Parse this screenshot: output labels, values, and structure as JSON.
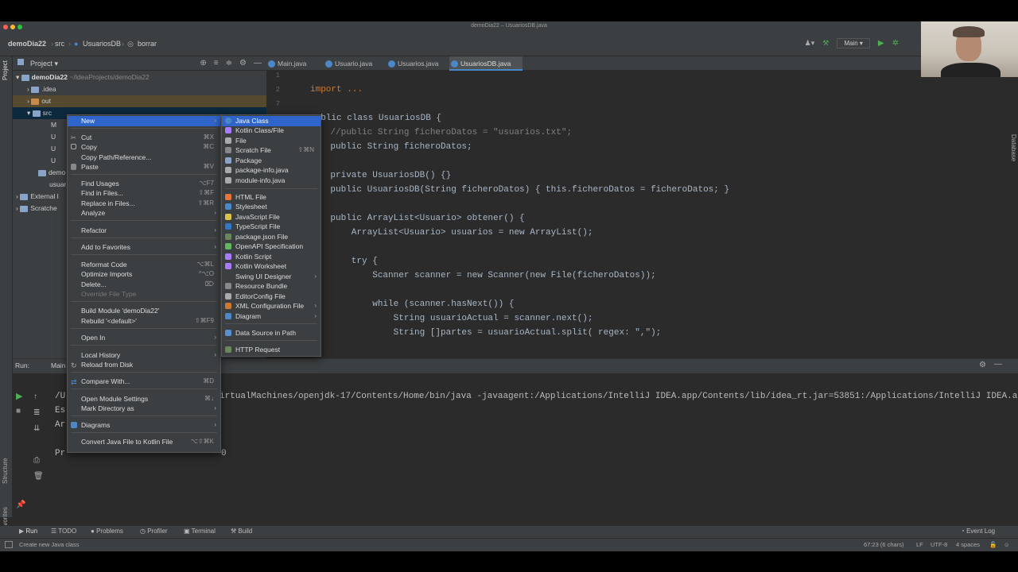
{
  "window": {
    "title": "demoDia22 – UsuariosDB.java"
  },
  "navbar": {
    "project": "demoDia22",
    "src": "src",
    "file": "UsuariosDB",
    "folder": "borrar",
    "run_config": "Main"
  },
  "project_panel": {
    "title": "Project",
    "strip_label": "Project",
    "root": "demoDia22",
    "root_path": "~/IdeaProjects/demoDia22",
    "items": [
      ".idea",
      "out",
      "src",
      "M",
      "U",
      "U",
      "U",
      "demo",
      "usuar",
      "External l",
      "Scratche"
    ]
  },
  "tabs": [
    {
      "label": "Main.java"
    },
    {
      "label": "Usuario.java"
    },
    {
      "label": "Usuarios.java"
    },
    {
      "label": "UsuariosDB.java"
    }
  ],
  "editor": {
    "line_numbers": [
      "1",
      "2",
      "7"
    ],
    "lines": [
      {
        "t": "import ..."
      },
      {
        "t": "public class UsuariosDB {"
      },
      {
        "t": "    //public String ficheroDatos = \"usuarios.txt\";"
      },
      {
        "t": "    public String ficheroDatos;"
      },
      {
        "t": "    private UsuariosDB() {}"
      },
      {
        "t": "    public UsuariosDB(String ficheroDatos) { this.ficheroDatos = ficheroDatos; }"
      },
      {
        "t": "    public ArrayList<Usuario> obtener() {"
      },
      {
        "t": "        ArrayList<Usuario> usuarios = new ArrayList();"
      },
      {
        "t": "        try {"
      },
      {
        "t": "            Scanner scanner = new Scanner(new File(ficheroDatos));"
      },
      {
        "t": "            while (scanner.hasNext()) {"
      },
      {
        "t": "                String usuarioActual = scanner.next();"
      },
      {
        "t": "                String []partes = usuarioActual.split( regex: \",\");"
      }
    ]
  },
  "run": {
    "label": "Run:",
    "tab": "Main",
    "cmd": "irtualMachines/openjdk-17/Contents/Home/bin/java -javaagent:/Applications/IntelliJ IDEA.app/Contents/lib/idea_rt.jar=53851:/Applications/IntelliJ IDEA.a",
    "out_lines": [
      "/U",
      "Es",
      "Ar",
      "",
      "Pr"
    ],
    "tail": "0"
  },
  "context_menu": [
    {
      "label": "New",
      "sub": true,
      "hl": true
    },
    {
      "label": "Cut",
      "sc": "⌘X"
    },
    {
      "label": "Copy",
      "sc": "⌘C"
    },
    {
      "label": "Copy Path/Reference..."
    },
    {
      "label": "Paste",
      "sc": "⌘V"
    },
    {
      "label": "Find Usages",
      "sc": "⌥F7"
    },
    {
      "label": "Find in Files...",
      "sc": "⇧⌘F"
    },
    {
      "label": "Replace in Files...",
      "sc": "⇧⌘R"
    },
    {
      "label": "Analyze",
      "sub": true
    },
    {
      "label": "Refactor",
      "sub": true
    },
    {
      "label": "Add to Favorites",
      "sub": true
    },
    {
      "label": "Reformat Code",
      "sc": "⌥⌘L"
    },
    {
      "label": "Optimize Imports",
      "sc": "^⌥O"
    },
    {
      "label": "Delete...",
      "sc": "⌦"
    },
    {
      "label": "Override File Type",
      "dis": true
    },
    {
      "label": "Build Module 'demoDia22'"
    },
    {
      "label": "Rebuild '<default>'",
      "sc": "⇧⌘F9"
    },
    {
      "label": "Open In",
      "sub": true
    },
    {
      "label": "Local History",
      "sub": true
    },
    {
      "label": "Reload from Disk"
    },
    {
      "label": "Compare With...",
      "sc": "⌘D"
    },
    {
      "label": "Open Module Settings",
      "sc": "⌘↓"
    },
    {
      "label": "Mark Directory as",
      "sub": true
    },
    {
      "label": "Diagrams",
      "sub": true
    },
    {
      "label": "Convert Java File to Kotlin File",
      "sc": "⌥⇧⌘K"
    }
  ],
  "submenu": [
    {
      "label": "Java Class",
      "hl": true
    },
    {
      "label": "Kotlin Class/File"
    },
    {
      "label": "File"
    },
    {
      "label": "Scratch File",
      "sc": "⇧⌘N"
    },
    {
      "label": "Package"
    },
    {
      "label": "package-info.java"
    },
    {
      "label": "module-info.java"
    },
    {
      "label": "HTML File"
    },
    {
      "label": "Stylesheet"
    },
    {
      "label": "JavaScript File"
    },
    {
      "label": "TypeScript File"
    },
    {
      "label": "package.json File"
    },
    {
      "label": "OpenAPI Specification"
    },
    {
      "label": "Kotlin Script"
    },
    {
      "label": "Kotlin Worksheet"
    },
    {
      "label": "Swing UI Designer",
      "sub": true
    },
    {
      "label": "Resource Bundle"
    },
    {
      "label": "EditorConfig File"
    },
    {
      "label": "XML Configuration File",
      "sub": true
    },
    {
      "label": "Diagram",
      "sub": true
    },
    {
      "label": "Data Source in Path"
    },
    {
      "label": "HTTP Request"
    }
  ],
  "bottom_tabs": [
    "Run",
    "TODO",
    "Problems",
    "Profiler",
    "Terminal",
    "Build"
  ],
  "event_log": "Event Log",
  "side_labels": [
    "Structure",
    "Favorites"
  ],
  "right_label": "Database",
  "status": {
    "message": "Create new Java class",
    "position": "67:23 (6 chars)",
    "line_sep": "LF",
    "encoding": "UTF-8",
    "indent": "4 spaces"
  }
}
